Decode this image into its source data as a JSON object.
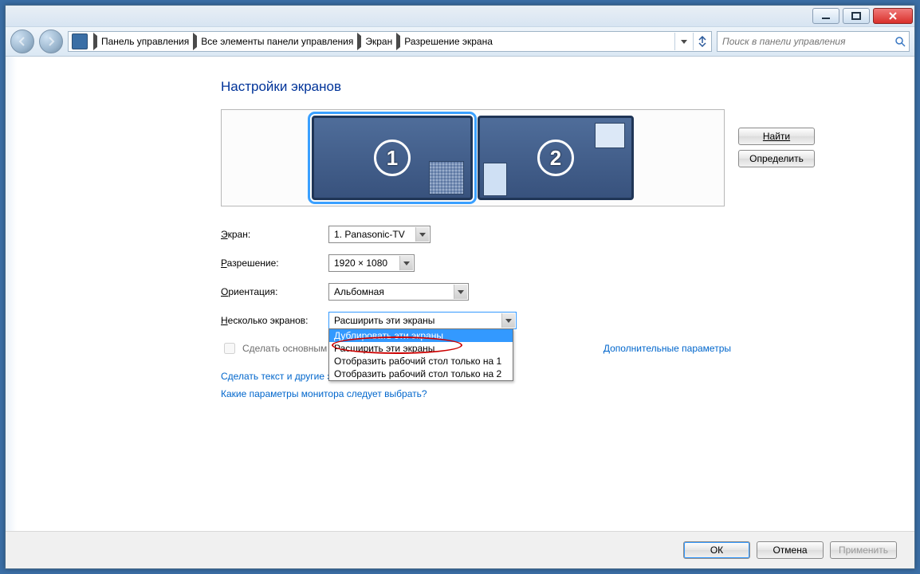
{
  "titlebar": {
    "minimize": "_",
    "maximize": "□",
    "close": "X"
  },
  "breadcrumbs": [
    "Панель управления",
    "Все элементы панели управления",
    "Экран",
    "Разрешение экрана"
  ],
  "search": {
    "placeholder": "Поиск в панели управления"
  },
  "page": {
    "title": "Настройки экранов",
    "btn_find": "Найти",
    "btn_detect": "Определить"
  },
  "monitors": {
    "m1": "1",
    "m2": "2"
  },
  "labels": {
    "display": "Экран:",
    "resolution": "Разрешение:",
    "orientation": "Ориентация:",
    "multi": "Несколько экранов:",
    "make_main": "Сделать основным монитором",
    "adv": "Дополнительные параметры"
  },
  "values": {
    "display": "1. Panasonic-TV",
    "resolution": "1920 × 1080",
    "orientation": "Альбомная",
    "multi": "Расширить эти экраны"
  },
  "multi_options": [
    "Дублировать эти экраны",
    "Расширить эти экраны",
    "Отобразить рабочий стол только на 1",
    "Отобразить рабочий стол только на 2"
  ],
  "links": {
    "text_size": "Сделать текст и другие элементы больше или меньше",
    "which_monitor": "Какие параметры монитора следует выбрать?"
  },
  "footer": {
    "ok": "ОК",
    "cancel": "Отмена",
    "apply": "Применить"
  }
}
